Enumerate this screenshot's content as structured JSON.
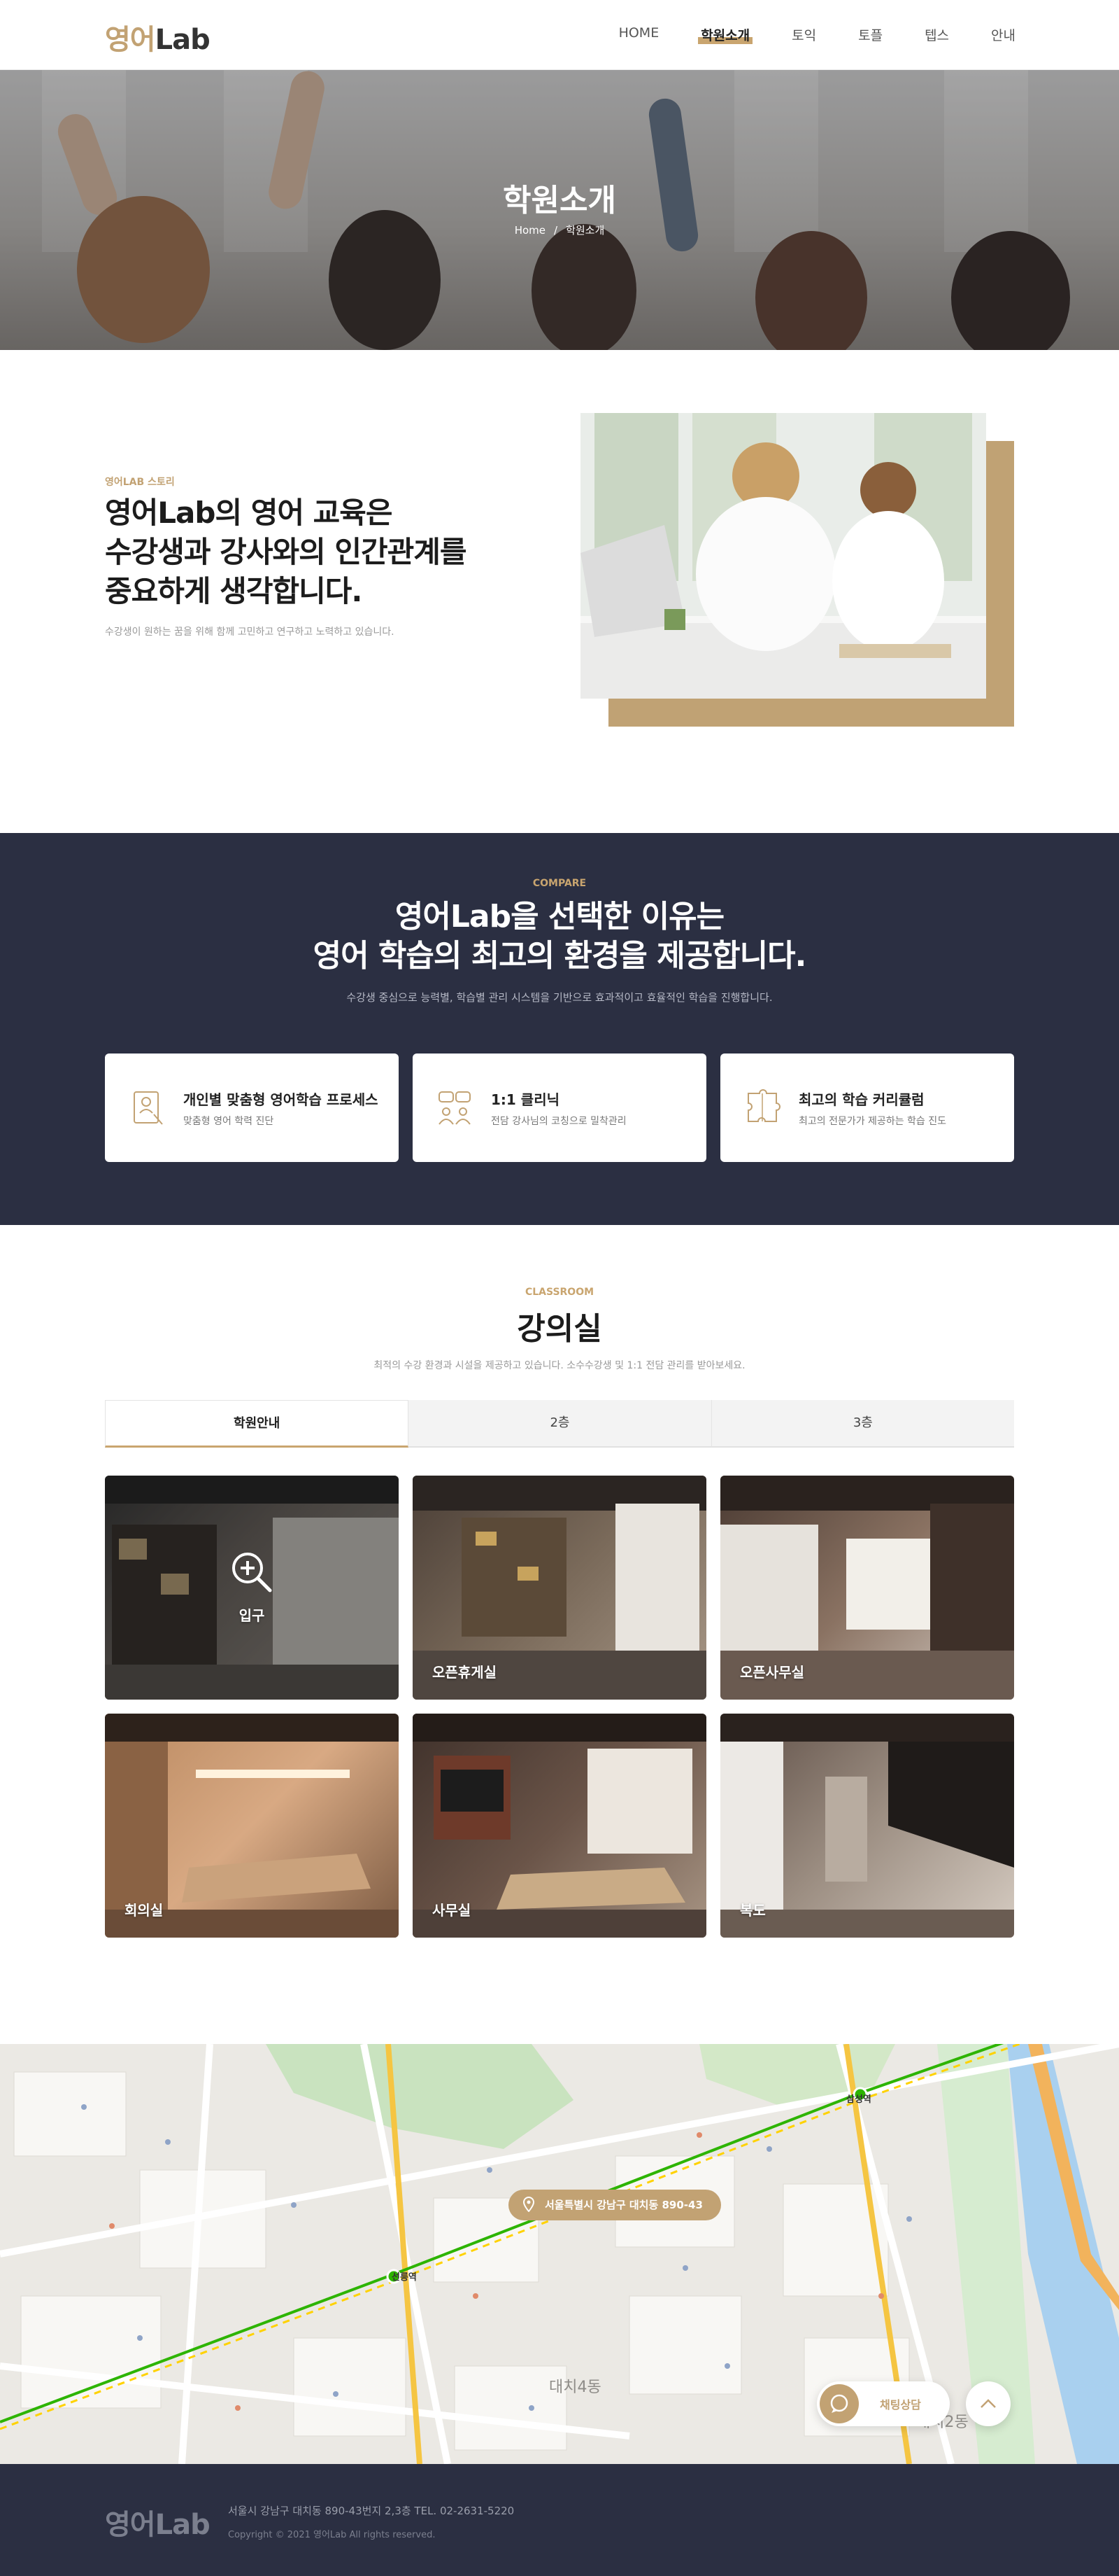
{
  "header": {
    "logo_korean": "영어",
    "logo_latin": "Lab",
    "nav": [
      "HOME",
      "학원소개",
      "토익",
      "토플",
      "텝스",
      "안내"
    ],
    "active_nav": "학원소개"
  },
  "hero": {
    "title": "학원소개",
    "breadcrumb": [
      "Home",
      "/",
      "학원소개"
    ]
  },
  "story": {
    "tag": "영어LAB 스토리",
    "title_lines": [
      "영어Lab의 영어 교육은",
      "수강생과 강사와의 인간관계를",
      "중요하게 생각합니다."
    ],
    "description": "수강생이 원하는 꿈을 위해 함께 고민하고 연구하고 노력하고 있습니다."
  },
  "compare": {
    "tag": "COMPARE",
    "title_lines": [
      "영어Lab을 선택한 이유는",
      "영어 학습의 최고의 환경을 제공합니다."
    ],
    "description": "수강생 중심으로 능력별, 학습별 관리 시스템을 기반으로 효과적이고 효율적인 학습을 진행합니다.",
    "cards": [
      {
        "icon": "document-person-icon",
        "title": "개인별 맞춤형 영어학습 프로세스",
        "desc": "맞춤형 영어 학력 진단"
      },
      {
        "icon": "conversation-icon",
        "title": "1:1 클리닉",
        "desc": "전담 강사님의 코칭으로 밀착관리"
      },
      {
        "icon": "puzzle-icon",
        "title": "최고의 학습 커리큘럼",
        "desc": "최고의 전문가가 제공하는 학습 진도"
      }
    ]
  },
  "classroom": {
    "tag": "CLASSROOM",
    "title": "강의실",
    "description": "최적의 수강 환경과 시설을 제공하고 있습니다. 소수수강생 및 1:1 전담 관리를 받아보세요.",
    "tabs": [
      "학원안내",
      "2층",
      "3층"
    ],
    "active_tab": "학원안내",
    "rooms": [
      "입구",
      "오픈휴게실",
      "오픈사무실",
      "회의실",
      "사무실",
      "복도"
    ]
  },
  "map": {
    "address_pin": "서울특별시 강남구 대치동 890-43",
    "labels": {
      "seolleung": "선릉역",
      "samseong": "삼성역",
      "daechi4": "대치4동",
      "daechi2": "대치2동"
    },
    "chat_label": "채팅상담"
  },
  "footer": {
    "logo": "영어Lab",
    "address": "서울시 강남구 대치동 890-43번지 2,3층 TEL. 02-2631-5220",
    "copyright": "Copyright © 2021 영어Lab All rights reserved."
  },
  "colors": {
    "accent": "#c2a273",
    "navy": "#2b2f42"
  }
}
